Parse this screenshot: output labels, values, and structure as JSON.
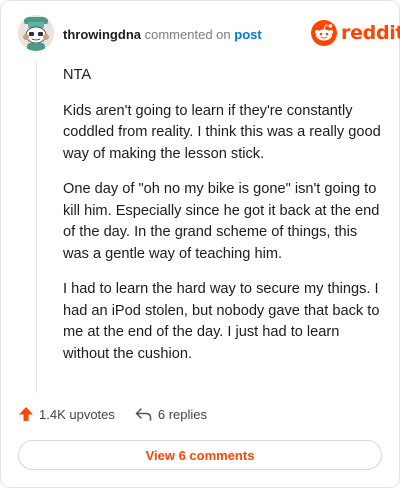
{
  "header": {
    "username": "throwingdna",
    "commented_text": "commented on",
    "post_link": "post",
    "logo_text": "reddit"
  },
  "comment": {
    "paragraphs": [
      "NTA",
      "Kids aren't going to learn if they're constantly coddled from reality. I think this was a really good way of making the lesson stick.",
      "One day of \"oh no my bike is gone\" isn't going to kill him. Especially since he got it back at the end of the day. In the grand scheme of things, this was a gentle way of teaching him.",
      "I had to learn the hard way to secure my things. I had an iPod stolen, but nobody gave that back to me at the end of the day. I just had to learn without the cushion."
    ]
  },
  "actions": {
    "upvotes": "1.4K upvotes",
    "replies": "6 replies",
    "view_comments": "View 6 comments"
  },
  "icons": {
    "avatar": "snoo-avatar",
    "logo": "reddit-snoo-icon",
    "upvote": "upvote-arrow-icon",
    "reply": "reply-arrow-icon"
  },
  "colors": {
    "brand": "#ff4500",
    "link": "#0079d3",
    "muted": "#7c7c7c",
    "avatar_bg": "#e9e4dd",
    "avatar_hat": "#4e9a8a"
  }
}
